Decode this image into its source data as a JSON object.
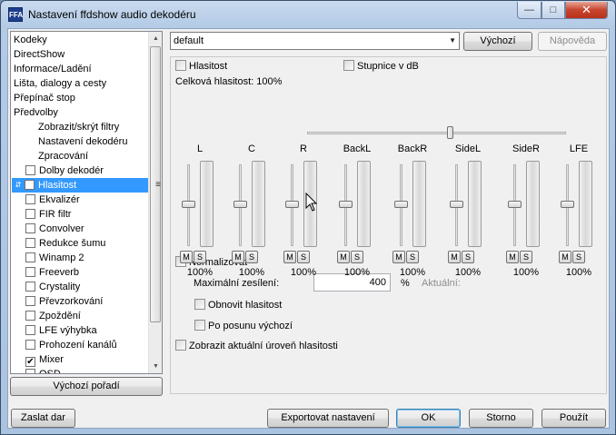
{
  "window": {
    "title": "Nastavení ffdshow audio dekodéru",
    "icon": "ffdshow-app-icon"
  },
  "sidebar": {
    "items": [
      {
        "label": "Kodeky",
        "type": "plain"
      },
      {
        "label": "DirectShow",
        "type": "plain"
      },
      {
        "label": "Informace/Ladění",
        "type": "plain"
      },
      {
        "label": "Lišta, dialogy a cesty",
        "type": "plain"
      },
      {
        "label": "Přepínač stop",
        "type": "plain"
      },
      {
        "label": "Předvolby",
        "type": "plain"
      },
      {
        "label": "Zobrazit/skrýt filtry",
        "type": "indent"
      },
      {
        "label": "Nastavení dekodéru",
        "type": "indent"
      },
      {
        "label": "Zpracování",
        "type": "indent"
      },
      {
        "label": "Dolby dekodér",
        "type": "check",
        "checked": false
      },
      {
        "label": "Hlasitost",
        "type": "check",
        "checked": false,
        "selected": true
      },
      {
        "label": "Ekvalizér",
        "type": "check",
        "checked": false
      },
      {
        "label": "FIR filtr",
        "type": "check",
        "checked": false
      },
      {
        "label": "Convolver",
        "type": "check",
        "checked": false
      },
      {
        "label": "Redukce šumu",
        "type": "check",
        "checked": false
      },
      {
        "label": "Winamp 2",
        "type": "check",
        "checked": false
      },
      {
        "label": "Freeverb",
        "type": "check",
        "checked": false
      },
      {
        "label": "Crystality",
        "type": "check",
        "checked": false
      },
      {
        "label": "Převzorkování",
        "type": "check",
        "checked": false
      },
      {
        "label": "Zpoždění",
        "type": "check",
        "checked": false
      },
      {
        "label": "LFE výhybka",
        "type": "check",
        "checked": false
      },
      {
        "label": "Prohození kanálů",
        "type": "check",
        "checked": false
      },
      {
        "label": "Mixer",
        "type": "check",
        "checked": true
      },
      {
        "label": "OSD",
        "type": "check",
        "checked": false
      }
    ],
    "reset_order_label": "Výchozí pořadí"
  },
  "preset": {
    "value": "default",
    "default_label": "Výchozí",
    "help_label": "Nápověda"
  },
  "volume": {
    "enable_label": "Hlasitost",
    "db_scale_label": "Stupnice v dB",
    "master_label": "Celková hlasitost: 100%",
    "master_level": 0.55,
    "channels": [
      {
        "name": "L",
        "mute": "M",
        "solo": "S",
        "value": "100%"
      },
      {
        "name": "C",
        "mute": "M",
        "solo": "S",
        "value": "100%"
      },
      {
        "name": "R",
        "mute": "M",
        "solo": "S",
        "value": "100%"
      },
      {
        "name": "BackL",
        "mute": "M",
        "solo": "S",
        "value": "100%"
      },
      {
        "name": "BackR",
        "mute": "M",
        "solo": "S",
        "value": "100%"
      },
      {
        "name": "SideL",
        "mute": "M",
        "solo": "S",
        "value": "100%"
      },
      {
        "name": "SideR",
        "mute": "M",
        "solo": "S",
        "value": "100%"
      },
      {
        "name": "LFE",
        "mute": "M",
        "solo": "S",
        "value": "100%"
      }
    ],
    "normalize_label": "Normalizovat",
    "max_gain_label": "Maximální zesílení:",
    "max_gain_value": "400",
    "max_gain_unit": "%",
    "current_label": "Aktuální:",
    "restore_label": "Obnovit hlasitost",
    "after_seek_label": "Po posunu výchozí",
    "show_level_label": "Zobrazit aktuální úroveň hlasitosti"
  },
  "footer": {
    "donate_label": "Zaslat dar",
    "export_label": "Exportovat nastavení",
    "ok_label": "OK",
    "cancel_label": "Storno",
    "apply_label": "Použít"
  }
}
